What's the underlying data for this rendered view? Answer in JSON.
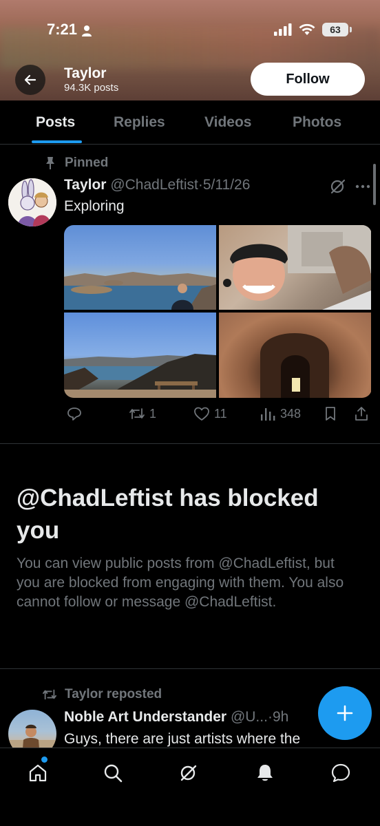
{
  "status_bar": {
    "time": "7:21",
    "battery": "63"
  },
  "header": {
    "name": "Taylor",
    "posts_count": "94.3K posts",
    "follow_label": "Follow"
  },
  "tabs": [
    {
      "label": "Posts",
      "active": true
    },
    {
      "label": "Replies",
      "active": false
    },
    {
      "label": "Videos",
      "active": false
    },
    {
      "label": "Photos",
      "active": false
    }
  ],
  "pinned_post": {
    "pinned_label": "Pinned",
    "author": "Taylor",
    "handle": "@ChadLeftist",
    "separator": "·",
    "date": "5/11/26",
    "text": "Exploring",
    "actions": {
      "retweets": "1",
      "likes": "11",
      "views": "348"
    }
  },
  "blocked_notice": {
    "title": "@ChadLeftist has blocked you",
    "body": "You can view public posts from @ChadLeftist, but you are blocked from engaging with them. You also cannot follow or message @ChadLeftist."
  },
  "repost": {
    "label": "Taylor reposted",
    "author": "Noble Art Understander",
    "handle": "@U...",
    "separator": "·",
    "time": "9h",
    "text": "Guys, there are just artists where the"
  },
  "colors": {
    "accent": "#1d9bf0",
    "muted": "#71767b",
    "text": "#e7e9ea",
    "background": "#000000"
  },
  "icons": {
    "back": "arrow-left-icon",
    "pin": "pin-icon",
    "grok": "grok-icon",
    "more": "more-icon",
    "reply": "reply-icon",
    "retweet": "retweet-icon",
    "like": "heart-icon",
    "views": "views-icon",
    "bookmark": "bookmark-icon",
    "share": "share-icon",
    "compose": "plus-icon",
    "nav": [
      "home-icon",
      "search-icon",
      "grok-icon",
      "bell-icon",
      "messages-icon"
    ]
  }
}
